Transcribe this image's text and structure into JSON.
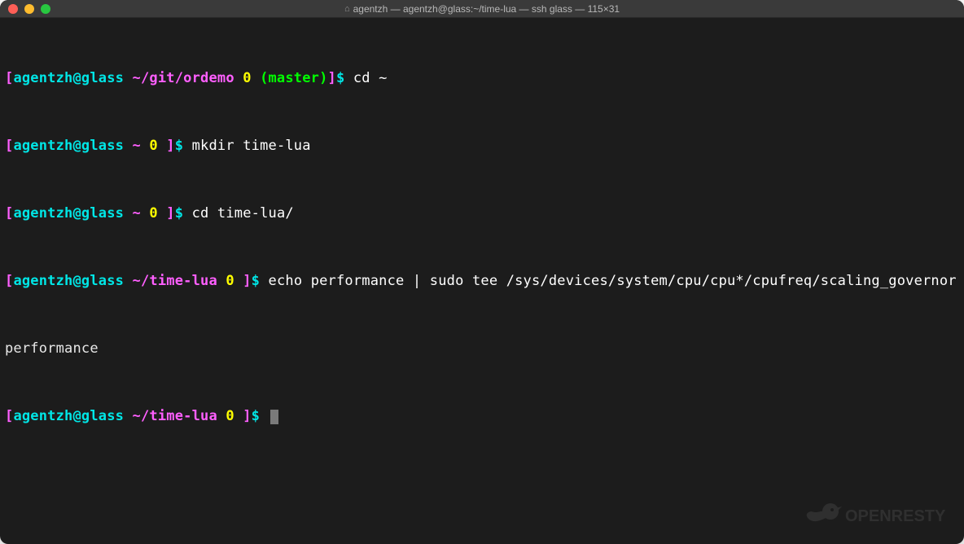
{
  "window": {
    "title": "agentzh — agentzh@glass:~/time-lua — ssh glass — 115×31"
  },
  "lines": [
    {
      "prompt": {
        "open": "[",
        "userhost": "agentzh@glass",
        "path": "~/git/ordemo",
        "exit": "0",
        "branch": "(master)",
        "close": "]",
        "dollar": "$"
      },
      "command": "cd ~"
    },
    {
      "prompt": {
        "open": "[",
        "userhost": "agentzh@glass",
        "path": "~",
        "exit": "0",
        "close": "]",
        "dollar": "$"
      },
      "command": "mkdir time-lua"
    },
    {
      "prompt": {
        "open": "[",
        "userhost": "agentzh@glass",
        "path": "~",
        "exit": "0",
        "close": "]",
        "dollar": "$"
      },
      "command": "cd time-lua/"
    },
    {
      "prompt": {
        "open": "[",
        "userhost": "agentzh@glass",
        "path": "~/time-lua",
        "exit": "0",
        "close": "]",
        "dollar": "$"
      },
      "command": "echo performance | sudo tee /sys/devices/system/cpu/cpu*/cpufreq/scaling_governor"
    },
    {
      "output": "performance"
    },
    {
      "prompt": {
        "open": "[",
        "userhost": "agentzh@glass",
        "path": "~/time-lua",
        "exit": "0",
        "close": "]",
        "dollar": "$"
      },
      "command": "",
      "cursor": true
    }
  ],
  "watermark": "OPENRESTY"
}
